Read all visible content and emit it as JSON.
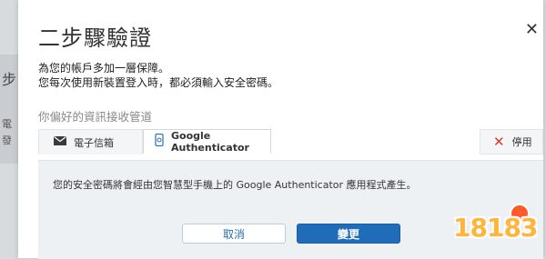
{
  "dialog": {
    "title": "二步驟驗證",
    "description_line1": "為您的帳戶多加一層保障。",
    "description_line2": "您每次使用新裝置登入時，都必須輸入安全密碼。"
  },
  "delivery": {
    "section_label": "你偏好的資訊接收管道",
    "tabs": [
      {
        "label": "電子信箱",
        "icon": "envelope-icon",
        "selected": false
      },
      {
        "label": "Google Authenticator",
        "icon": "phone-icon",
        "selected": true
      }
    ],
    "disable_label": "停用",
    "disable_icon": "close-icon"
  },
  "panel": {
    "text": "您的安全密碼將會經由您智慧型手機上的 Google Authenticator 應用程式產生。"
  },
  "buttons": {
    "cancel": "取消",
    "change": "變更"
  },
  "background": {
    "fragment_a": "步",
    "fragment_b": "電",
    "fragment_c": "發"
  },
  "watermark": {
    "text": "18183"
  },
  "colors": {
    "primary": "#1f6db9",
    "danger": "#d63b2f",
    "panel_bg": "#eef1f4",
    "watermark": "#ffb43b"
  }
}
